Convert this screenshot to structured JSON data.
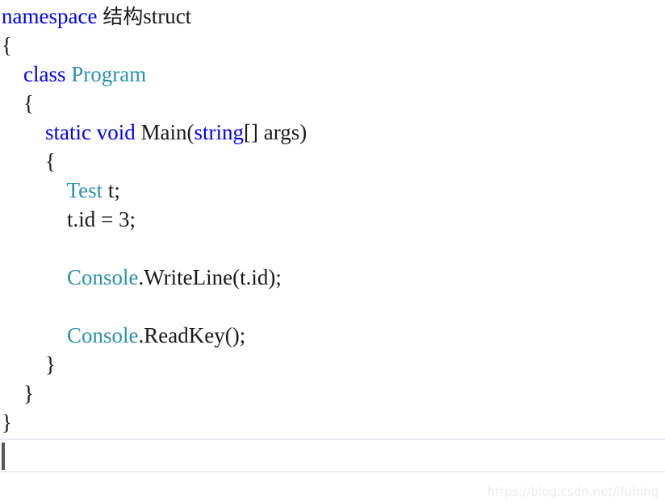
{
  "editor": {
    "language": "csharp",
    "colors": {
      "keyword": "#0000FF",
      "type": "#2B91AF",
      "plain": "#1A1A1A",
      "background": "#FFFFFF"
    },
    "lines": [
      {
        "indent": 0,
        "tokens": [
          {
            "kind": "keyword",
            "text": "namespace"
          },
          {
            "kind": "plain",
            "text": " "
          },
          {
            "kind": "cjk",
            "text": "结构"
          },
          {
            "kind": "plain",
            "text": "struct"
          }
        ]
      },
      {
        "indent": 0,
        "tokens": [
          {
            "kind": "brace",
            "text": "{"
          }
        ]
      },
      {
        "indent": 1,
        "tokens": [
          {
            "kind": "keyword",
            "text": "class"
          },
          {
            "kind": "plain",
            "text": " "
          },
          {
            "kind": "type",
            "text": "Program"
          }
        ]
      },
      {
        "indent": 1,
        "tokens": [
          {
            "kind": "brace",
            "text": "{"
          }
        ]
      },
      {
        "indent": 2,
        "tokens": [
          {
            "kind": "keyword",
            "text": "static"
          },
          {
            "kind": "plain",
            "text": " "
          },
          {
            "kind": "keyword",
            "text": "void"
          },
          {
            "kind": "plain",
            "text": " Main("
          },
          {
            "kind": "keyword",
            "text": "string"
          },
          {
            "kind": "plain",
            "text": "[] args)"
          }
        ]
      },
      {
        "indent": 2,
        "tokens": [
          {
            "kind": "brace",
            "text": "{"
          }
        ]
      },
      {
        "indent": 3,
        "tokens": [
          {
            "kind": "type",
            "text": "Test"
          },
          {
            "kind": "plain",
            "text": " t;"
          }
        ]
      },
      {
        "indent": 3,
        "tokens": [
          {
            "kind": "plain",
            "text": "t.id = "
          },
          {
            "kind": "number",
            "text": "3"
          },
          {
            "kind": "plain",
            "text": ";"
          }
        ]
      },
      {
        "indent": 0,
        "blank": true,
        "tokens": []
      },
      {
        "indent": 3,
        "tokens": [
          {
            "kind": "type",
            "text": "Console"
          },
          {
            "kind": "plain",
            "text": ".WriteLine(t.id);"
          }
        ]
      },
      {
        "indent": 0,
        "blank": true,
        "tokens": []
      },
      {
        "indent": 3,
        "tokens": [
          {
            "kind": "type",
            "text": "Console"
          },
          {
            "kind": "plain",
            "text": ".ReadKey();"
          }
        ]
      },
      {
        "indent": 2,
        "tokens": [
          {
            "kind": "brace",
            "text": "}"
          }
        ]
      },
      {
        "indent": 1,
        "tokens": [
          {
            "kind": "brace",
            "text": "}"
          }
        ]
      },
      {
        "indent": 0,
        "tokens": [
          {
            "kind": "brace",
            "text": "}"
          }
        ]
      }
    ]
  },
  "input_bar": {
    "value": "",
    "caret_visible": true
  },
  "watermark": {
    "text": "https://blog.csdn.net/ifubing"
  }
}
